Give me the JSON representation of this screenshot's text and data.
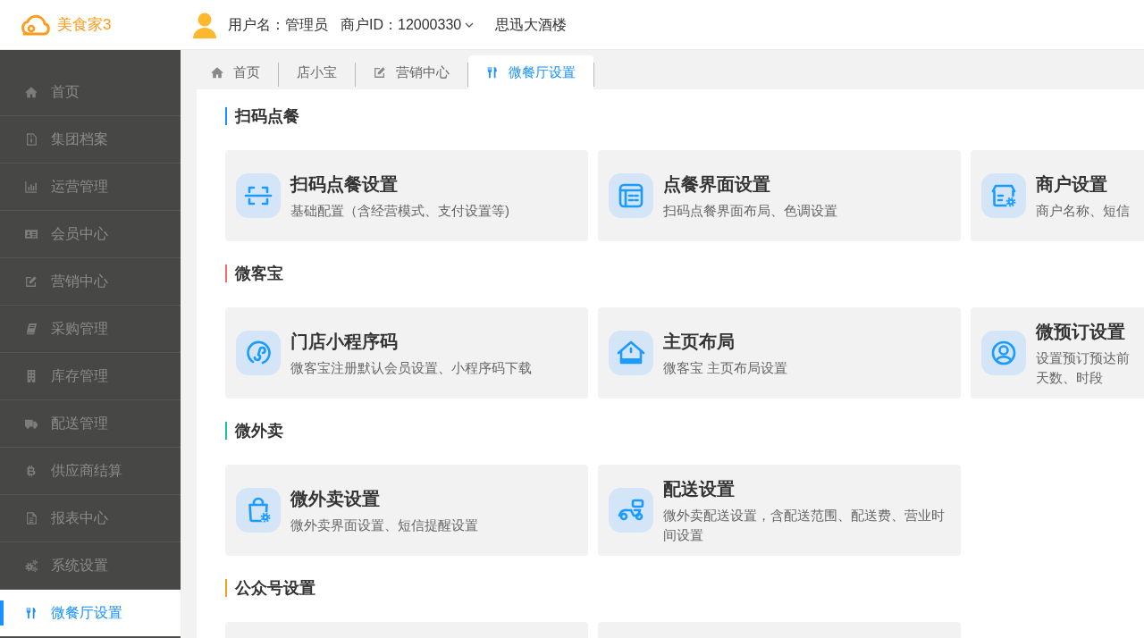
{
  "header": {
    "logo": "美食家3",
    "username": "用户名：管理员",
    "merchant_id": "商户ID：12000330",
    "store": "思迅大酒楼"
  },
  "sidebar": {
    "items": [
      {
        "label": "首页",
        "selected": false
      },
      {
        "label": "集团档案",
        "selected": false
      },
      {
        "label": "运营管理",
        "selected": false
      },
      {
        "label": "会员中心",
        "selected": false
      },
      {
        "label": "营销中心",
        "selected": false
      },
      {
        "label": "采购管理",
        "selected": false
      },
      {
        "label": "库存管理",
        "selected": false
      },
      {
        "label": "配送管理",
        "selected": false
      },
      {
        "label": "供应商结算",
        "selected": false
      },
      {
        "label": "报表中心",
        "selected": false
      },
      {
        "label": "系统设置",
        "selected": false
      },
      {
        "label": "微餐厅设置",
        "selected": true
      }
    ]
  },
  "tabs": [
    {
      "label": "首页",
      "selected": false
    },
    {
      "label": "店小宝",
      "selected": false
    },
    {
      "label": "营销中心",
      "selected": false
    },
    {
      "label": "微餐厅设置",
      "selected": true
    }
  ],
  "sections": [
    {
      "title": "扫码点餐",
      "color": "#1890ff",
      "cards": [
        {
          "kind": "setting",
          "title": "扫码点餐设置",
          "description": "基础配置（含经营模式、支付设置等)"
        },
        {
          "kind": "setting",
          "title": "点餐界面设置",
          "description": "扫码点餐界面布局、色调设置"
        },
        {
          "kind": "setting",
          "title": "商户设置",
          "description": "商户名称、短信"
        }
      ]
    },
    {
      "title": "微客宝",
      "color": "#f26b6b",
      "cards": [
        {
          "kind": "setting",
          "title": "门店小程序码",
          "description": "微客宝注册默认会员设置、小程序码下载"
        },
        {
          "kind": "setting",
          "title": "主页布局",
          "description": "微客宝 主页布局设置"
        },
        {
          "kind": "setting",
          "title": "微预订设置",
          "description": "设置预订预达前",
          "description_continued": "天数、时段"
        }
      ]
    },
    {
      "title": "微外卖",
      "color": "#1fbba6",
      "cards": [
        {
          "kind": "setting",
          "title": "微外卖设置",
          "description": "微外卖界面设置、短信提醒设置"
        },
        {
          "kind": "setting",
          "title": "配送设置",
          "description": "微外卖配送设置，含配送范围、配送费、营业时间设置"
        }
      ]
    },
    {
      "title": "公众号设置",
      "color": "#f0a020",
      "cards": [
        {
          "kind": "stub"
        },
        {
          "kind": "stub"
        }
      ]
    }
  ]
}
